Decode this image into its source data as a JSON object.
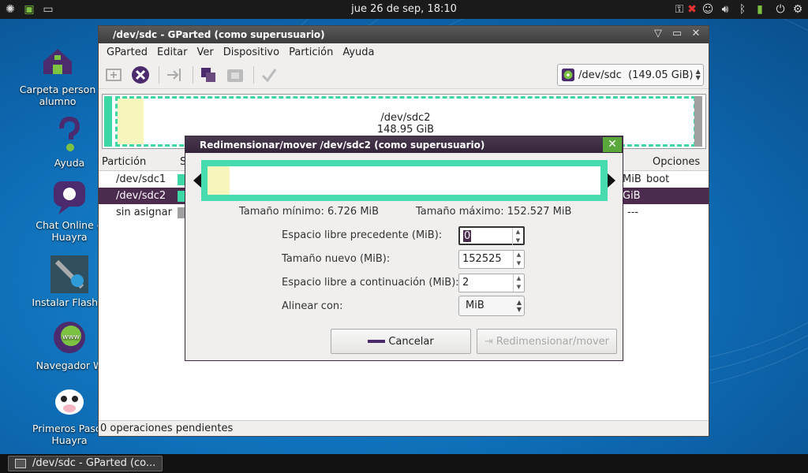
{
  "top_panel": {
    "clock": "jue 26 de sep, 18:10"
  },
  "desktop_icons": [
    {
      "label": "Carpeta person alumno"
    },
    {
      "label": "Ayuda"
    },
    {
      "label": "Chat Online d Huayra"
    },
    {
      "label": "Instalar Flash P"
    },
    {
      "label": "Navegador W"
    },
    {
      "label": "Primeros Pasos Huayra"
    }
  ],
  "window": {
    "title": "/dev/sdc - GParted (como superusuario)",
    "menu": [
      "GParted",
      "Editar",
      "Ver",
      "Dispositivo",
      "Partición",
      "Ayuda"
    ],
    "device_selector": "/dev/sdc  (149.05 GiB)",
    "disk_map": {
      "partition_name": "/dev/sdc2",
      "partition_size": "148.95 GiB",
      "used_fraction": 0.045
    },
    "table": {
      "headers": {
        "partition": "Partición",
        "second_col": "S",
        "options": "Opciones"
      },
      "rows": [
        {
          "partition": "/dev/sdc1",
          "size_tail": "MiB",
          "options": "boot",
          "color": "#3cd7a4",
          "selected": false
        },
        {
          "partition": "/dev/sdc2",
          "size_tail": "GiB",
          "options": "",
          "color": "#3cd7a4",
          "selected": true
        },
        {
          "partition": "sin asignar",
          "size_tail": "---",
          "options": "",
          "color": "#a0a0a0",
          "selected": false
        }
      ]
    },
    "status": "0 operaciones pendientes"
  },
  "dialog": {
    "title": "Redimensionar/mover /dev/sdc2 (como superusuario)",
    "min_size": "Tamaño mínimo: 6.726 MiB",
    "max_size": "Tamaño máximo: 152.527 MiB",
    "fields": [
      {
        "label": "Espacio libre precedente (MiB):",
        "value": "0"
      },
      {
        "label": "Tamaño nuevo (MiB):",
        "value": "152525"
      },
      {
        "label": "Espacio libre a continuación (MiB):",
        "value": "2"
      }
    ],
    "align_label": "Alinear con:",
    "align_value": "MiB",
    "cancel_label": "Cancelar",
    "resize_label": "Redimensionar/mover"
  },
  "taskbar": {
    "item": "/dev/sdc - GParted (co..."
  },
  "colors": {
    "ext4_partition": "#3cd7a4",
    "used_space": "#f8f5bd",
    "unallocated": "#a0a0a0",
    "selection": "#4b2b4e"
  }
}
